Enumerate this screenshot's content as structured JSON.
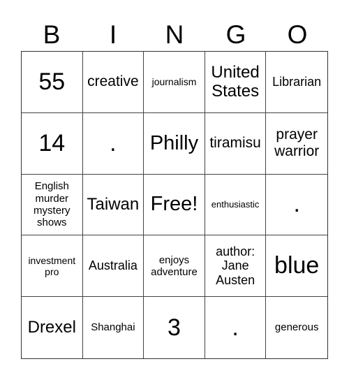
{
  "header": {
    "letters": [
      "B",
      "I",
      "N",
      "G",
      "O"
    ]
  },
  "cells": [
    [
      "55",
      "creative",
      "journalism",
      "United States",
      "Librarian"
    ],
    [
      "14",
      ".",
      "Philly",
      "tiramisu",
      "prayer warrior"
    ],
    [
      "English murder mystery shows",
      "Taiwan",
      "Free!",
      "enthusiastic",
      "."
    ],
    [
      "investment pro",
      "Australia",
      "enjoys adventure",
      "author: Jane Austen",
      "blue"
    ],
    [
      "Drexel",
      "Shanghai",
      "3",
      ".",
      "generous"
    ]
  ]
}
